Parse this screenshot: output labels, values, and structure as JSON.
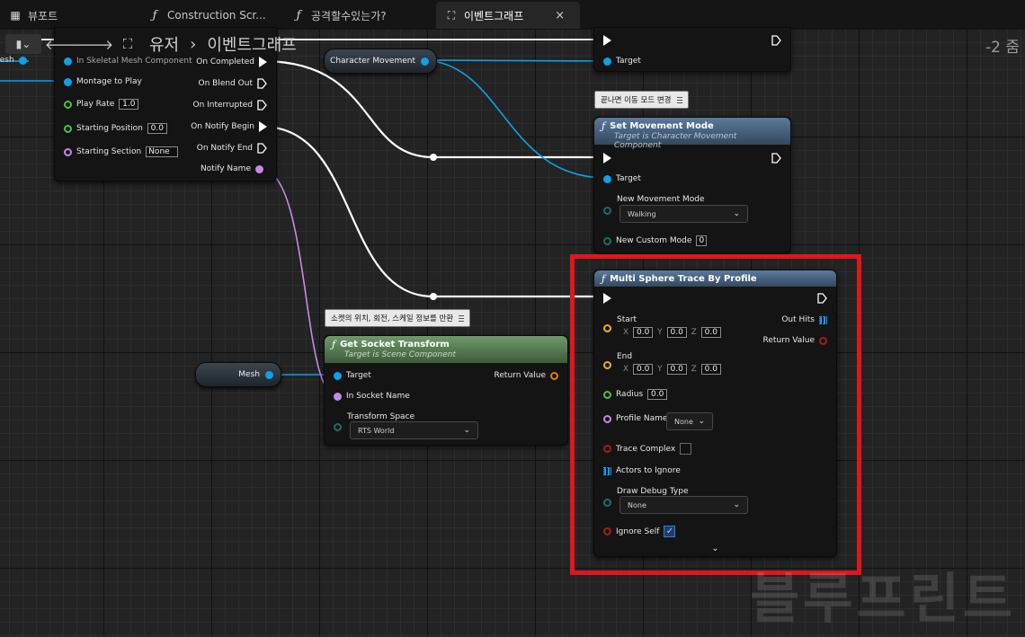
{
  "tabs": [
    {
      "icon": "viewport-icon",
      "label": "뷰포트"
    },
    {
      "icon": "function-icon",
      "label": "Construction Scr..."
    },
    {
      "icon": "function-icon",
      "label": "공격할수있는가?"
    },
    {
      "icon": "event-graph-icon",
      "label": "이벤트그래프",
      "active": true,
      "close": "×"
    }
  ],
  "breadcrumb": {
    "items": [
      "유저",
      "이벤트그래프"
    ],
    "separator": "›"
  },
  "zoom_label": "-2 줌",
  "montage_node": {
    "inputs": {
      "skeletal": "In Skeletal Mesh Component",
      "montage": "Montage to Play",
      "play_rate": "Play Rate",
      "play_rate_val": "1.0",
      "start_pos": "Starting Position",
      "start_pos_val": "0.0",
      "start_section": "Starting Section",
      "start_section_val": "None"
    },
    "outputs": {
      "completed": "On Completed",
      "blend_out": "On Blend Out",
      "interrupted": "On Interrupted",
      "notify_begin": "On Notify Begin",
      "notify_end": "On Notify End",
      "notify_name": "Notify Name"
    },
    "left_stub": "Mesh"
  },
  "char_movement_var": "Character Movement",
  "top_call_node": {
    "target": "Target"
  },
  "comment_movement": "끝나면 이동 모드 변경",
  "set_movement": {
    "title": "Set Movement Mode",
    "subtitle": "Target is Character Movement Component",
    "target": "Target",
    "new_mode": "New Movement Mode",
    "new_mode_val": "Walking",
    "custom_mode": "New Custom Mode",
    "custom_mode_val": "0"
  },
  "comment_socket": "소켓의 위치, 회전, 스케일 정보를 반환",
  "mesh_var": "Mesh",
  "get_socket": {
    "title": "Get Socket Transform",
    "subtitle": "Target is Scene Component",
    "target": "Target",
    "return_value": "Return Value",
    "socket_name": "In Socket Name",
    "transform_space": "Transform Space",
    "transform_space_val": "RTS World"
  },
  "multi_sphere": {
    "title": "Multi Sphere Trace By Profile",
    "start": "Start",
    "end": "End",
    "x": "X",
    "y": "Y",
    "z": "Z",
    "start_vals": [
      "0.0",
      "0.0",
      "0.0"
    ],
    "end_vals": [
      "0.0",
      "0.0",
      "0.0"
    ],
    "out_hits": "Out Hits",
    "return_value": "Return Value",
    "radius": "Radius",
    "radius_val": "0.0",
    "profile_name": "Profile Name",
    "profile_name_val": "None",
    "trace_complex": "Trace Complex",
    "actors_ignore": "Actors to Ignore",
    "draw_debug": "Draw Debug Type",
    "draw_debug_val": "None",
    "ignore_self": "Ignore Self",
    "ignore_self_checked": true
  },
  "watermark": "블루프린트",
  "colors": {
    "exec": "#ffffff",
    "object": "#0ea0e8",
    "vector": "#e8b21c",
    "float": "#49c23e",
    "name": "#c987e8",
    "bool": "#a41d1d",
    "highlight": "#e0161e"
  }
}
